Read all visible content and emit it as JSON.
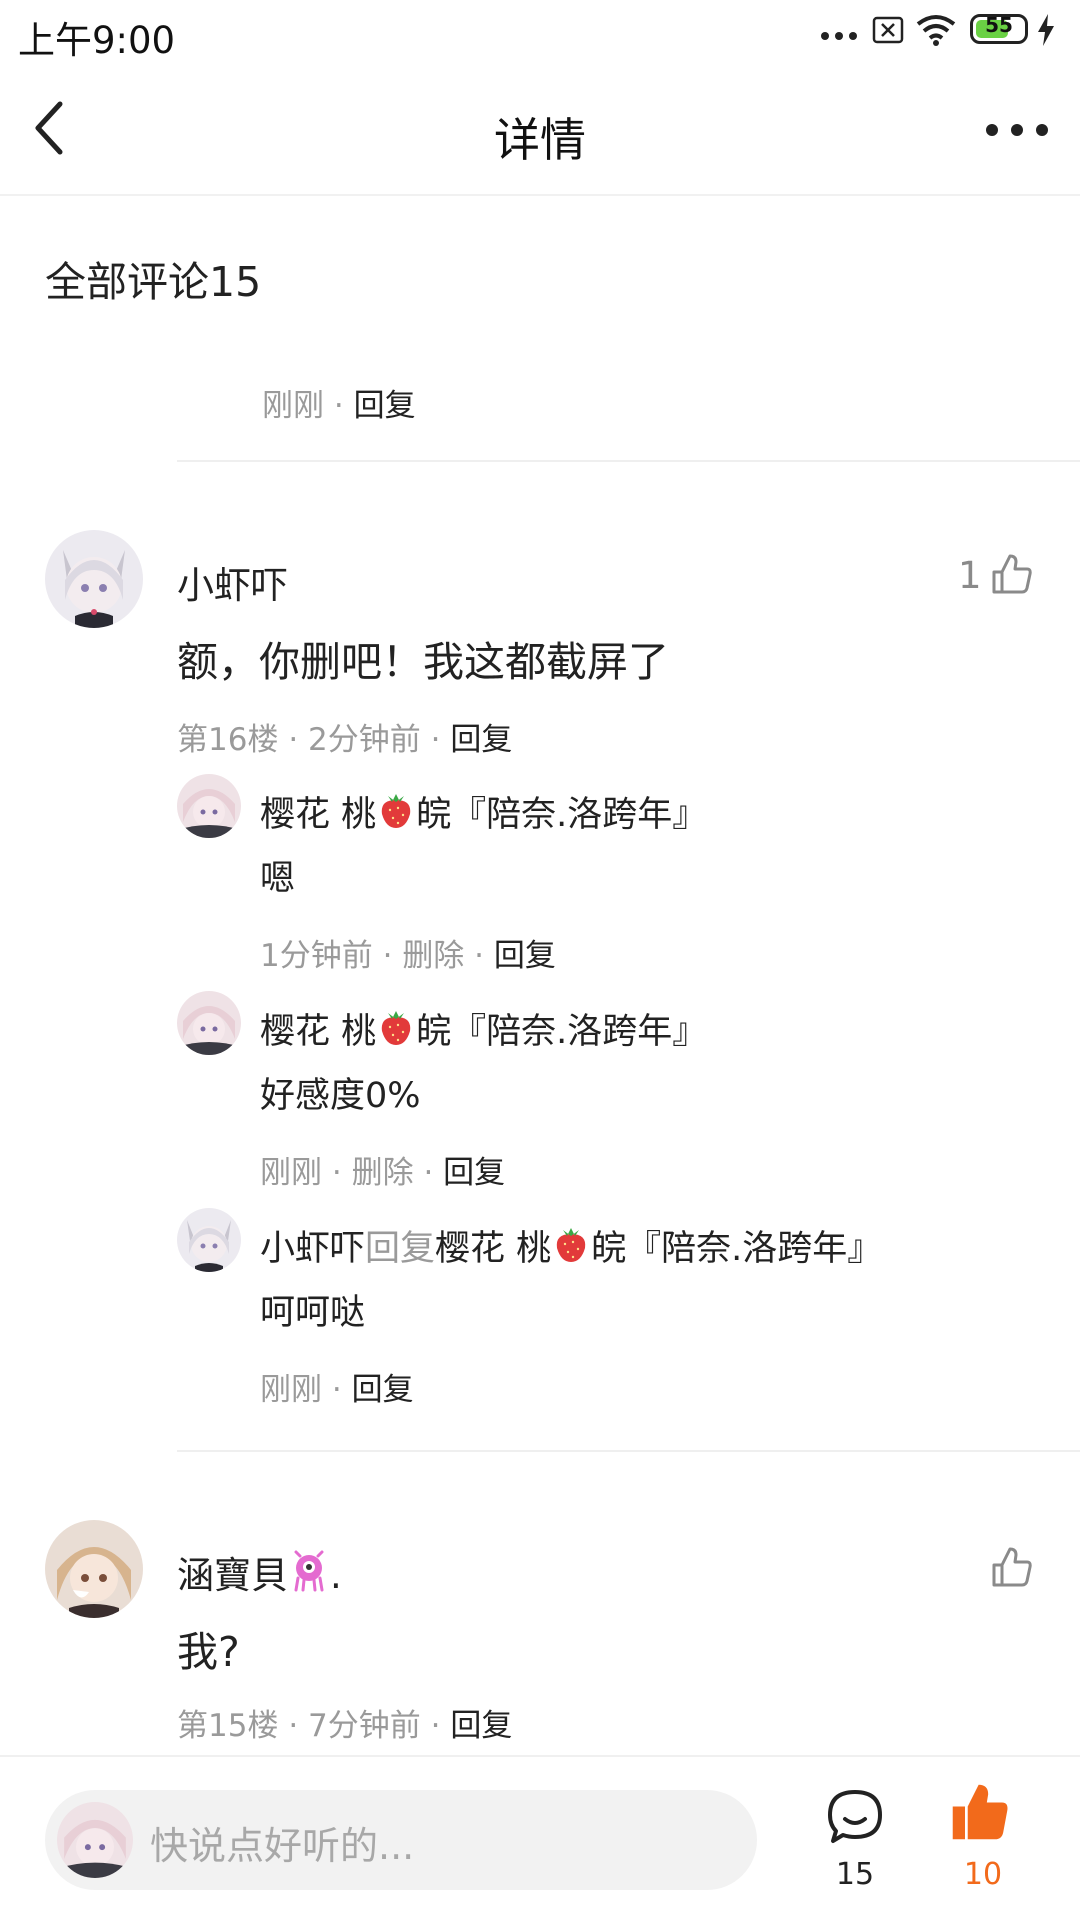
{
  "status_bar": {
    "time": "上午9:00",
    "battery": "55",
    "icons": [
      "more-dots-icon",
      "sim-x-icon",
      "wifi-icon",
      "battery-icon",
      "charging-icon"
    ]
  },
  "navbar": {
    "title": "详情"
  },
  "comments_section": {
    "title": "全部评论15"
  },
  "top_partial": {
    "time": "刚刚",
    "reply": "回复"
  },
  "comments": [
    {
      "user": "小虾吓",
      "content": "额，你删吧！我这都截屏了",
      "likes": "1",
      "floor": "第16楼",
      "time": "2分钟前",
      "reply": "回复",
      "replies": [
        {
          "user": "樱花 桃",
          "user_suffix": "皖『陪奈.洛跨年』",
          "content": "嗯",
          "time": "1分钟前",
          "delete": "删除",
          "reply": "回复"
        },
        {
          "user": "樱花 桃",
          "user_suffix": "皖『陪奈.洛跨年』",
          "content": "好感度0%",
          "time": "刚刚",
          "delete": "删除",
          "reply": "回复"
        },
        {
          "user": "小虾吓",
          "reply_word": "回复",
          "target_user": "樱花 桃",
          "target_suffix": "皖『陪奈.洛跨年』",
          "content": "呵呵哒",
          "time": "刚刚",
          "reply": "回复"
        }
      ]
    },
    {
      "user": "涵寶貝",
      "user_suffix": ".",
      "content": "我?",
      "floor": "第15楼",
      "time": "7分钟前",
      "reply": "回复"
    }
  ],
  "bottom_bar": {
    "placeholder": "快说点好听的...",
    "comment_count": "15",
    "like_count": "10"
  },
  "colors": {
    "accent": "#f26a1b",
    "meta_gray": "#9a9a9a",
    "divider": "#efefef"
  }
}
